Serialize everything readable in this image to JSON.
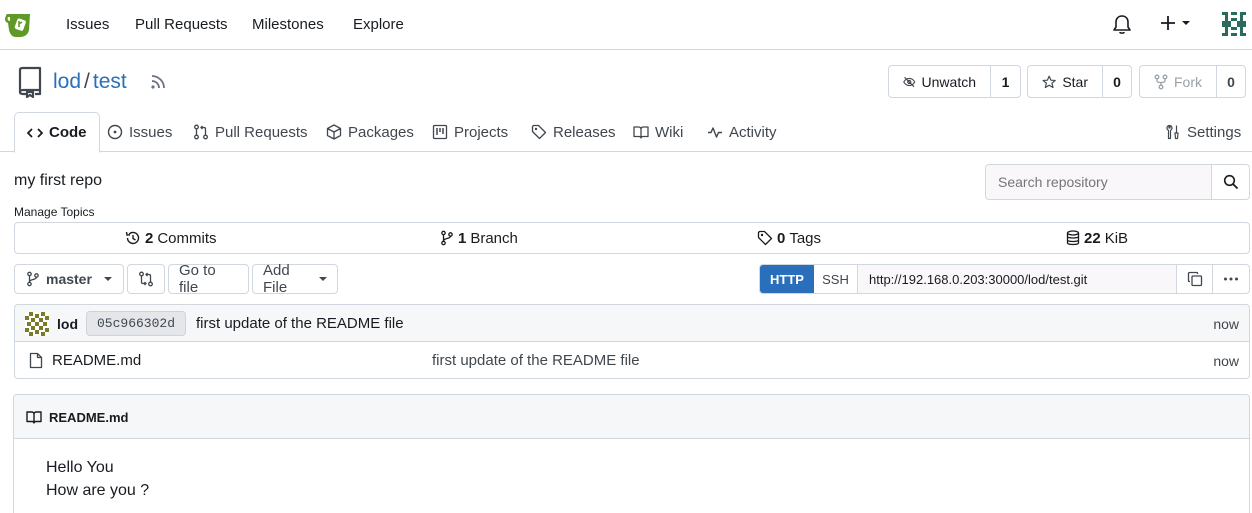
{
  "nav": {
    "links": [
      "Issues",
      "Pull Requests",
      "Milestones",
      "Explore"
    ],
    "icons": [
      "gitea-logo-icon",
      "bell-icon",
      "plus-icon",
      "user-avatar"
    ]
  },
  "repo": {
    "owner": "lod",
    "separator": "/",
    "name": "test",
    "watch_label": "Unwatch",
    "watch_count": "1",
    "star_label": "Star",
    "star_count": "0",
    "fork_label": "Fork",
    "fork_count": "0"
  },
  "tabs": {
    "code": "Code",
    "issues": "Issues",
    "pulls": "Pull Requests",
    "packages": "Packages",
    "projects": "Projects",
    "releases": "Releases",
    "wiki": "Wiki",
    "activity": "Activity",
    "settings": "Settings"
  },
  "description": "my first repo",
  "manage_topics": "Manage Topics",
  "search": {
    "placeholder": "Search repository"
  },
  "stats": {
    "commits_num": "2",
    "commits_label": "Commits",
    "branch_num": "1",
    "branch_label": "Branch",
    "tags_num": "0",
    "tags_label": "Tags",
    "size_num": "22",
    "size_label": "KiB"
  },
  "toolbar": {
    "branch": "master",
    "go_to_file": "Go to file",
    "add_file": "Add File",
    "http": "HTTP",
    "ssh": "SSH",
    "clone_url": "http://192.168.0.203:30000/lod/test.git"
  },
  "latest_commit": {
    "author": "lod",
    "sha": "05c966302d",
    "message": "first update of the README file",
    "time": "now"
  },
  "files": [
    {
      "name": "README.md",
      "message": "first update of the README file",
      "time": "now"
    }
  ],
  "readme": {
    "title": "README.md",
    "lines": [
      "Hello You",
      "How are you ?"
    ]
  },
  "colors": {
    "accent": "#2a6fbb",
    "logo_green": "#609926"
  }
}
